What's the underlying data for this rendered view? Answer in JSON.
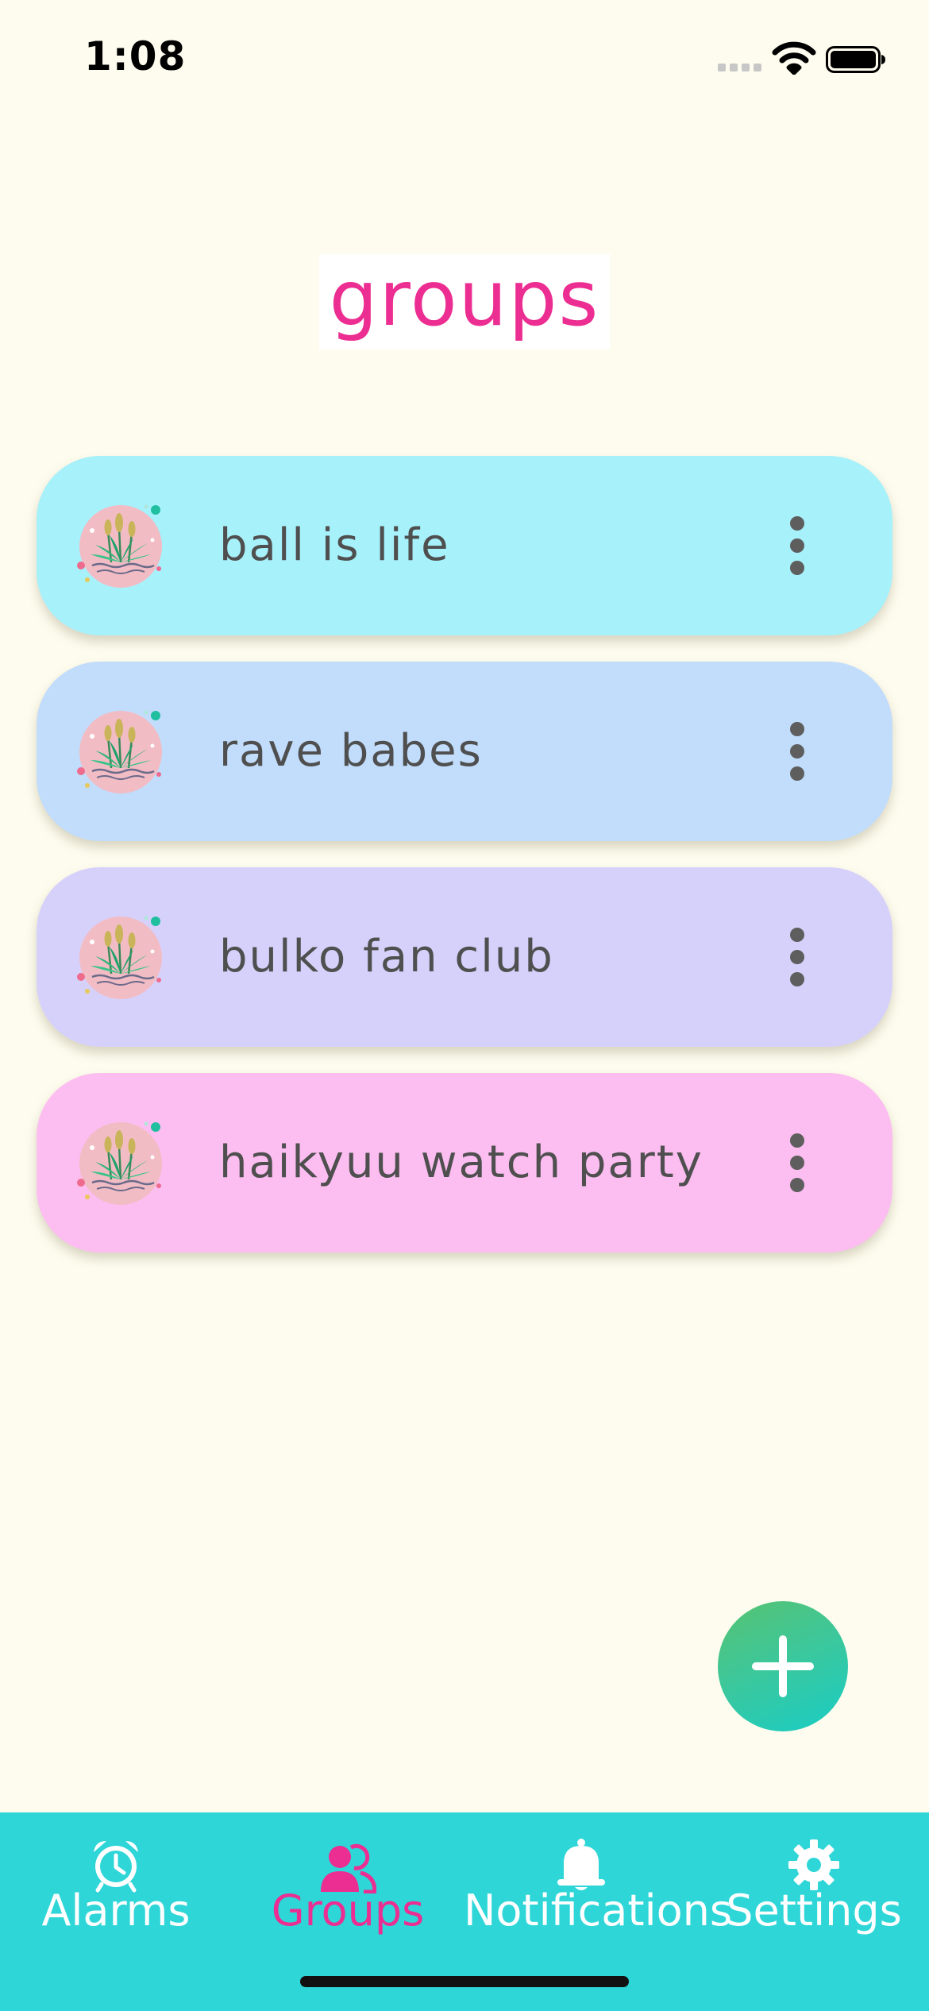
{
  "status_bar": {
    "time": "1:08"
  },
  "page": {
    "title": "groups"
  },
  "groups": [
    {
      "name": "ball is life",
      "color": "#a7f1fb",
      "avatar_icon": "reeds-pond-icon",
      "menu_icon": "more-vertical-icon"
    },
    {
      "name": "rave babes",
      "color": "#c1ddfb",
      "avatar_icon": "reeds-pond-icon",
      "menu_icon": "more-vertical-icon"
    },
    {
      "name": "bulko fan club",
      "color": "#d6d1fb",
      "avatar_icon": "reeds-pond-icon",
      "menu_icon": "more-vertical-icon"
    },
    {
      "name": "haikyuu watch party",
      "color": "#fcbdf1",
      "avatar_icon": "reeds-pond-icon",
      "menu_icon": "more-vertical-icon"
    }
  ],
  "fab": {
    "icon": "plus-icon"
  },
  "tab_bar": {
    "active": "groups",
    "tabs": [
      {
        "id": "alarms",
        "label": "Alarms",
        "icon": "alarm-clock-icon"
      },
      {
        "id": "groups",
        "label": "Groups",
        "icon": "people-icon"
      },
      {
        "id": "notifications",
        "label": "Notifications",
        "icon": "bell-icon"
      },
      {
        "id": "settings",
        "label": "Settings",
        "icon": "gear-icon"
      }
    ]
  },
  "colors": {
    "background": "#fefcee",
    "title": "#ec2d91",
    "tab_bar": "#2ed6d8",
    "tab_active": "#ec2d91",
    "tab_inactive": "#ffffff",
    "card_text": "#4f4f4f"
  }
}
